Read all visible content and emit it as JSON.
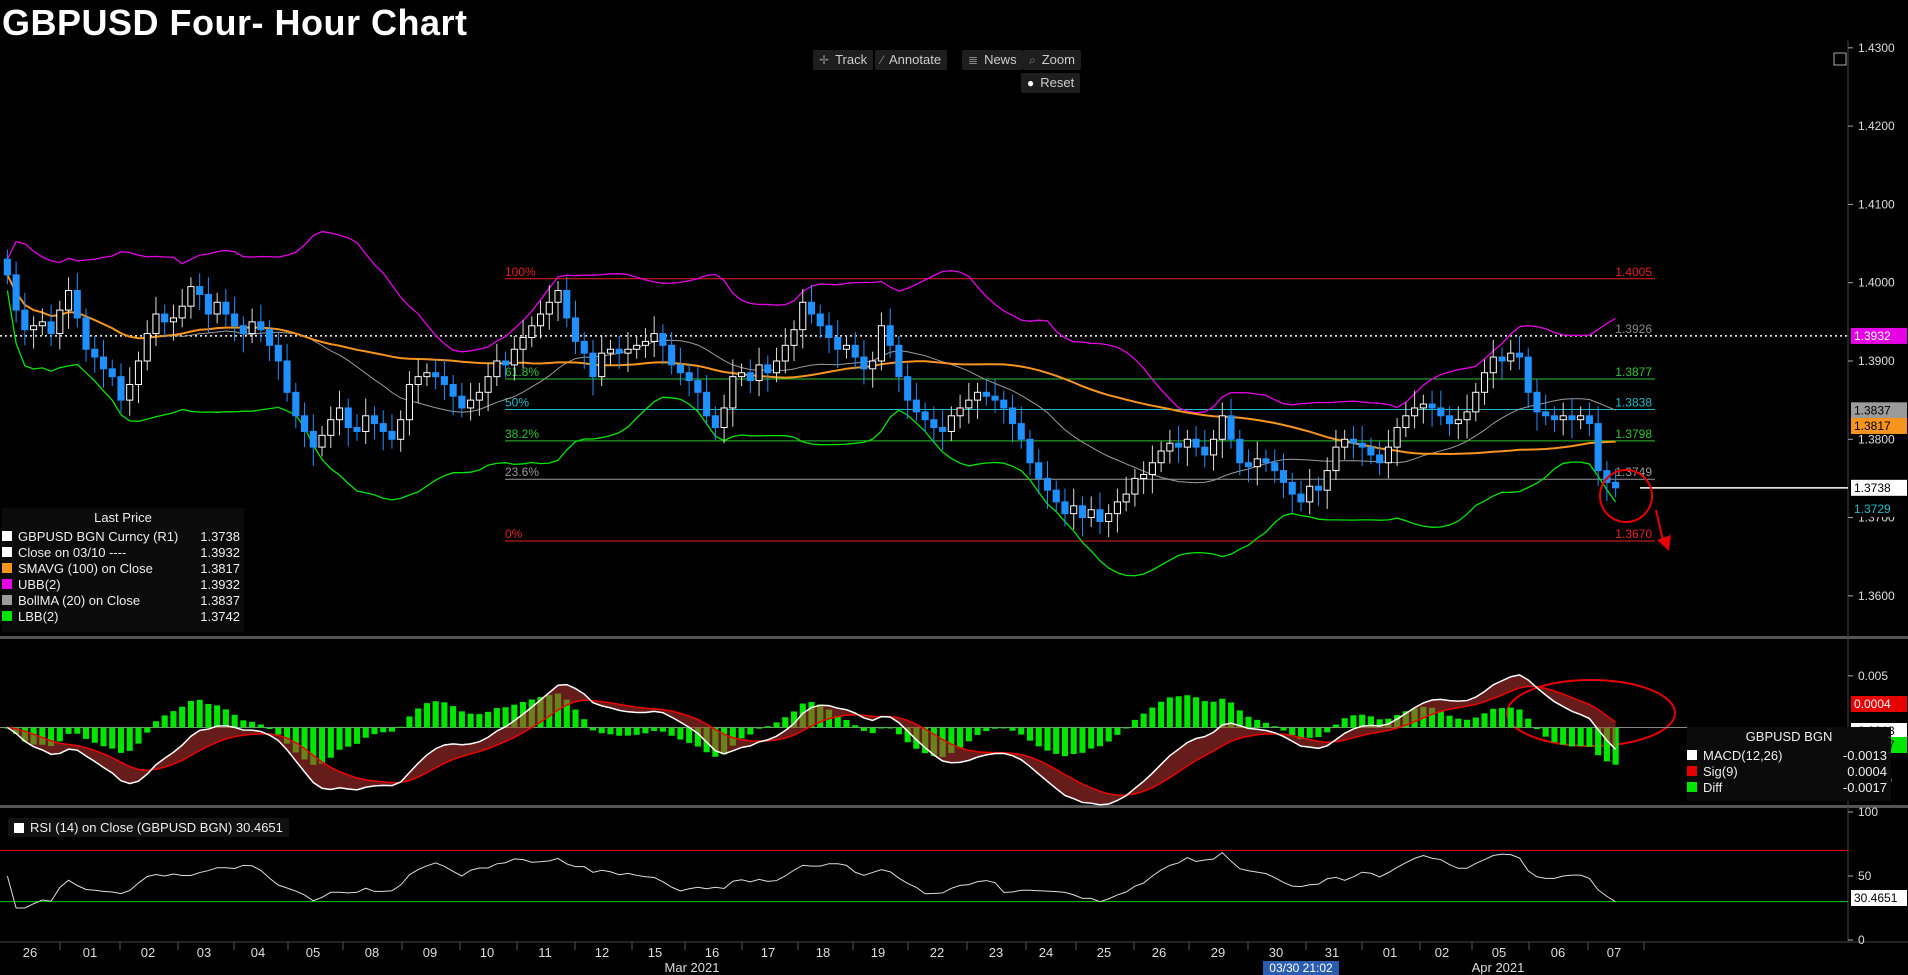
{
  "title": "GBPUSD Four- Hour Chart",
  "toolbar": {
    "track": "Track",
    "annotate": "Annotate",
    "news": "News",
    "zoom": "Zoom",
    "reset": "Reset"
  },
  "legend_price": {
    "header": "Last Price",
    "items": [
      {
        "name": "GBPUSD BGN Curncy  (R1)",
        "value": "1.3738",
        "color": "#ffffff"
      },
      {
        "name": "Close on 03/10 ----",
        "value": "1.3932",
        "color": "#ffffff"
      },
      {
        "name": "SMAVG (100)  on Close",
        "value": "1.3817",
        "color": "#f7941d"
      },
      {
        "name": "UBB(2)",
        "value": "1.3932",
        "color": "#e600e6"
      },
      {
        "name": "BollMA (20)  on Close",
        "value": "1.3837",
        "color": "#9b9b9b"
      },
      {
        "name": "LBB(2)",
        "value": "1.3742",
        "color": "#00e600"
      }
    ]
  },
  "legend_macd": {
    "header": "GBPUSD BGN",
    "items": [
      {
        "name": "MACD(12,26)",
        "value": "-0.0013",
        "color": "#ffffff"
      },
      {
        "name": "Sig(9)",
        "value": "0.0004",
        "color": "#e60000"
      },
      {
        "name": "Diff",
        "value": "-0.0017",
        "color": "#00e600"
      }
    ]
  },
  "rsi_legend": "RSI (14)  on Close (GBPUSD BGN) 30.4651",
  "fib_levels": [
    {
      "pct": "100%",
      "value": "1.4005",
      "color": "#e62020"
    },
    {
      "pct": "61.8%",
      "value": "1.3877",
      "color": "#2ec42e"
    },
    {
      "pct": "50%",
      "value": "1.3838",
      "color": "#22b8c8"
    },
    {
      "pct": "38.2%",
      "value": "1.3798",
      "color": "#2ec42e"
    },
    {
      "pct": "23.6%",
      "value": "1.3749",
      "color": "#9b9b9b"
    },
    {
      "pct": "0%",
      "value": "1.3670",
      "color": "#e62020"
    }
  ],
  "hline_close_label": "1.3926",
  "price_axis_ticks": [
    "1.4300",
    "1.4200",
    "1.4100",
    "1.4000",
    "1.3900",
    "1.3800",
    "1.3700",
    "1.3600"
  ],
  "price_tags": [
    {
      "text": "1.3932",
      "value": 1.3932,
      "bg": "#e600e6",
      "fg": "#ffffff"
    },
    {
      "text": "1.3837",
      "value": 1.3837,
      "bg": "#9b9b9b",
      "fg": "#000000"
    },
    {
      "text": "1.3817",
      "value": 1.3817,
      "bg": "#f7941d",
      "fg": "#000000"
    },
    {
      "text": "1.3738",
      "value": 1.3738,
      "bg": "#ffffff",
      "fg": "#000000"
    },
    {
      "text": "1.3729",
      "value": 1.3729,
      "bg": "#000000",
      "fg": "#22b8c8"
    }
  ],
  "macd_axis_ticks": [
    "0.005",
    "0.000",
    "-0.005"
  ],
  "macd_tags": [
    {
      "text": "0.0004",
      "value": 0.0004,
      "bg": "#e60000",
      "fg": "#ffffff"
    },
    {
      "text": "-0.0013",
      "value": -0.0013,
      "bg": "#ffffff",
      "fg": "#000000"
    },
    {
      "text": "-0.0017",
      "value": -0.0017,
      "bg": "#00e600",
      "fg": "#000000"
    }
  ],
  "rsi_axis_ticks": [
    "100",
    "50",
    "0"
  ],
  "rsi_tag": "30.4651",
  "x_axis": {
    "days": [
      "26",
      "01",
      "02",
      "03",
      "04",
      "05",
      "08",
      "09",
      "10",
      "11",
      "12",
      "15",
      "16",
      "17",
      "18",
      "19",
      "22",
      "23",
      "24",
      "25",
      "26",
      "29",
      "30",
      "31",
      "01",
      "02",
      "05",
      "06",
      "07"
    ],
    "months": [
      "Mar 2021",
      "Apr 2021"
    ],
    "crosshair": "03/30 21:02"
  },
  "colors": {
    "up_candle": "#ffffff",
    "down_candle": "#1e90ff",
    "sma": "#f7941d",
    "ubb": "#e600e6",
    "lbb": "#00e600",
    "bollma": "#9b9b9b",
    "annotation": "#e60000"
  },
  "chart_data": {
    "type": "candlestick",
    "instrument": "GBPUSD",
    "price_ylim": [
      1.355,
      1.431
    ],
    "macd_ylim": [
      -0.0075,
      0.0075
    ],
    "rsi_ylim": [
      0,
      100
    ],
    "rsi_overbought": 70,
    "rsi_oversold": 30,
    "close_series": [
      1.401,
      1.3965,
      1.394,
      1.3945,
      1.395,
      1.3935,
      1.3965,
      1.399,
      1.3955,
      1.3915,
      1.3905,
      1.389,
      1.388,
      1.385,
      1.387,
      1.39,
      1.3935,
      1.396,
      1.395,
      1.3955,
      1.397,
      1.3995,
      1.3985,
      1.396,
      1.3975,
      1.396,
      1.3945,
      1.3935,
      1.395,
      1.394,
      1.392,
      1.39,
      1.386,
      1.383,
      1.381,
      1.379,
      1.3805,
      1.3825,
      1.384,
      1.3815,
      1.381,
      1.383,
      1.382,
      1.381,
      1.38,
      1.3825,
      1.387,
      1.388,
      1.3885,
      1.388,
      1.387,
      1.3855,
      1.384,
      1.385,
      1.386,
      1.388,
      1.39,
      1.3895,
      1.3915,
      1.393,
      1.3945,
      1.396,
      1.3975,
      1.399,
      1.3955,
      1.3925,
      1.391,
      1.388,
      1.391,
      1.3915,
      1.391,
      1.3915,
      1.392,
      1.3925,
      1.3935,
      1.392,
      1.3895,
      1.3885,
      1.3875,
      1.386,
      1.383,
      1.3815,
      1.384,
      1.388,
      1.3885,
      1.3875,
      1.3895,
      1.3885,
      1.39,
      1.392,
      1.394,
      1.3975,
      1.396,
      1.3945,
      1.393,
      1.3915,
      1.392,
      1.3905,
      1.389,
      1.39,
      1.3945,
      1.392,
      1.388,
      1.385,
      1.3835,
      1.3825,
      1.3815,
      1.381,
      1.383,
      1.384,
      1.385,
      1.386,
      1.3855,
      1.385,
      1.384,
      1.382,
      1.38,
      1.377,
      1.375,
      1.3735,
      1.372,
      1.3705,
      1.3715,
      1.37,
      1.371,
      1.3695,
      1.3705,
      1.372,
      1.373,
      1.375,
      1.3755,
      1.377,
      1.3785,
      1.3795,
      1.379,
      1.38,
      1.379,
      1.378,
      1.38,
      1.383,
      1.38,
      1.377,
      1.3765,
      1.3775,
      1.377,
      1.376,
      1.3745,
      1.373,
      1.372,
      1.374,
      1.3735,
      1.376,
      1.379,
      1.38,
      1.3795,
      1.379,
      1.378,
      1.377,
      1.379,
      1.3815,
      1.383,
      1.384,
      1.3845,
      1.384,
      1.383,
      1.382,
      1.3825,
      1.3835,
      1.386,
      1.3885,
      1.3905,
      1.39,
      1.391,
      1.3905,
      1.386,
      1.3835,
      1.383,
      1.3825,
      1.383,
      1.3825,
      1.383,
      1.382,
      1.376,
      1.3745,
      1.3738
    ]
  }
}
